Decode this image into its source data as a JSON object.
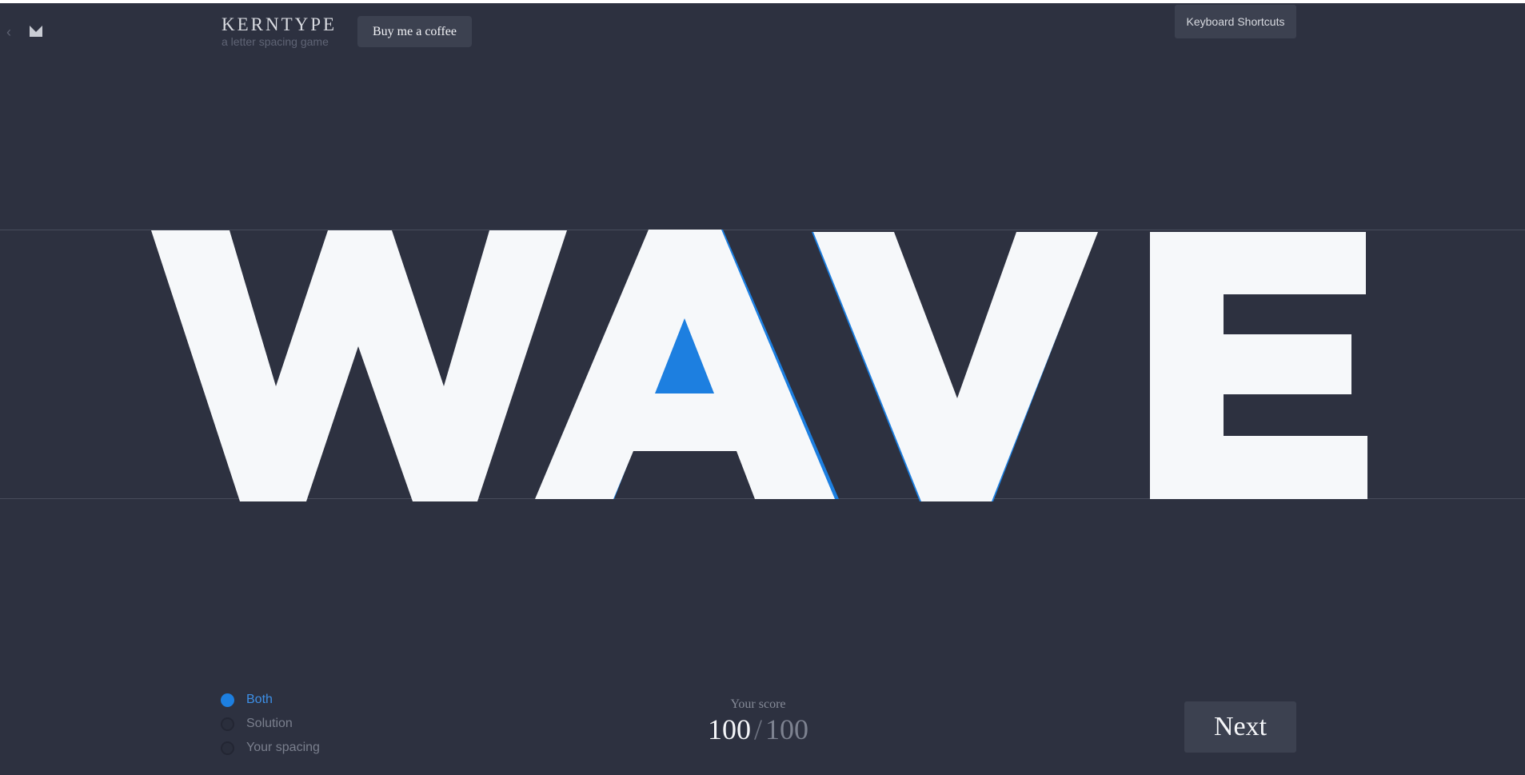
{
  "header": {
    "back_icon": "chevron-left-icon",
    "logo_icon": "m-logo-icon",
    "title": "KERNTYPE",
    "subtitle": "a letter spacing game",
    "coffee_label": "Buy me a coffee",
    "shortcuts_label": "Keyboard Shortcuts"
  },
  "game": {
    "word": "WAVE",
    "letters": [
      "W",
      "A",
      "V",
      "E"
    ]
  },
  "view_options": [
    {
      "label": "Both",
      "selected": true
    },
    {
      "label": "Solution",
      "selected": false
    },
    {
      "label": "Your spacing",
      "selected": false
    }
  ],
  "score": {
    "label": "Your score",
    "value": "100",
    "separator": "/",
    "max": "100"
  },
  "next_label": "Next",
  "colors": {
    "background": "#2d3140",
    "letter": "#f6f8fa",
    "solution_outline": "#1d7fe0",
    "button": "#3c4150"
  }
}
